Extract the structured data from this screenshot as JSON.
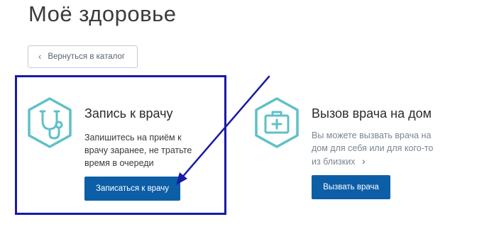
{
  "page": {
    "title": "Моё здоровье"
  },
  "back_button": {
    "icon": "chevron-left-icon",
    "label": "Вернуться в каталог"
  },
  "cards": [
    {
      "icon": "stethoscope-icon",
      "title": "Запись к врачу",
      "description": "Запишитесь на приём к врачу заранее, не тратьте время в очереди",
      "button_label": "Записаться к врачу"
    },
    {
      "icon": "first-aid-kit-icon",
      "title": "Вызов врача на дом",
      "description": "Вы можете вызвать врача на дом для себя или для кого-то из близких",
      "more_icon": "chevron-right-icon",
      "button_label": "Вызвать врача"
    }
  ],
  "colors": {
    "accent": "#0c5fa6",
    "icon_teal": "#5fc0c8",
    "annotation": "#1a1aa5",
    "text": "#2b2b2b",
    "muted_text": "#7b8590"
  }
}
